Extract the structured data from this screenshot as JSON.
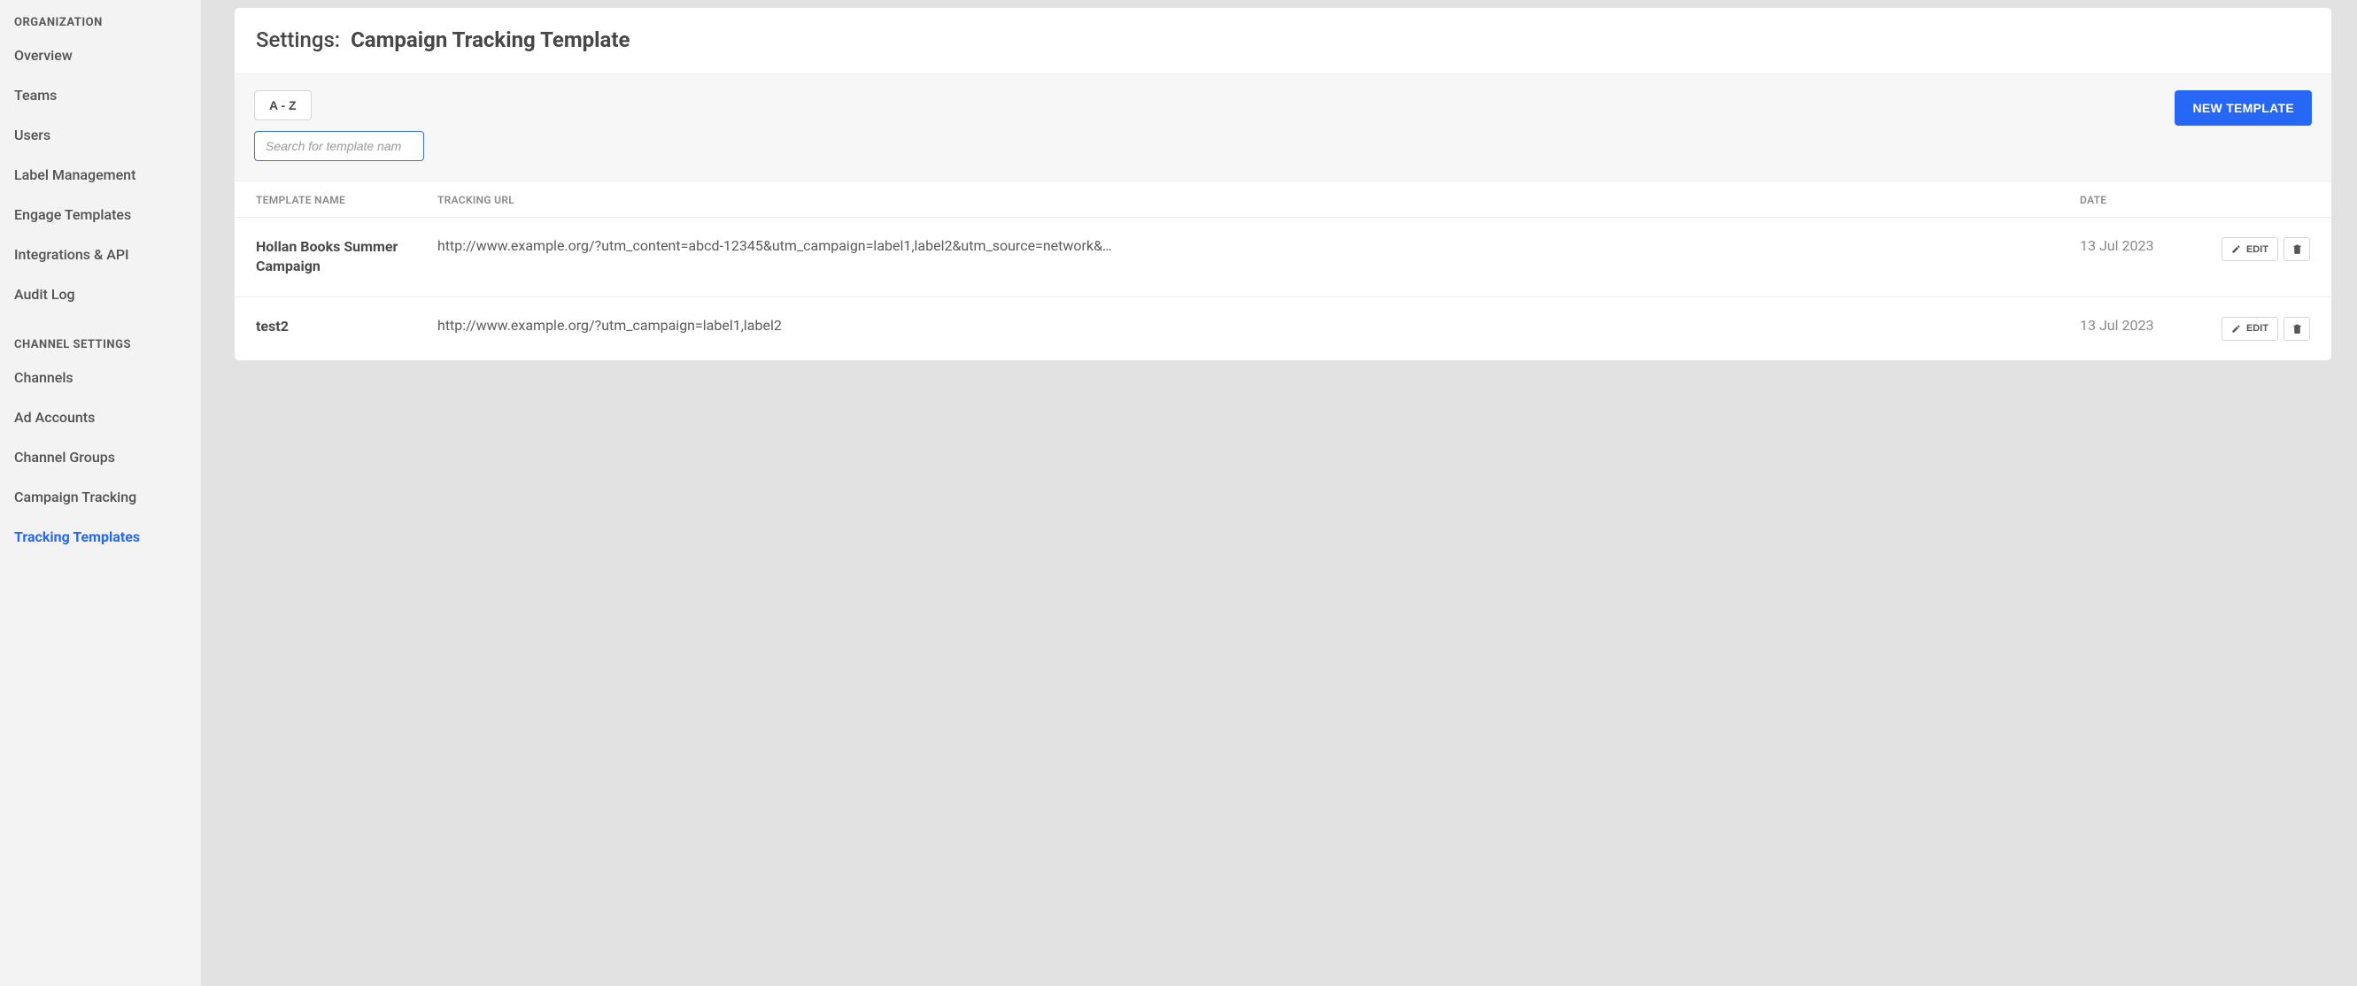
{
  "sidebar": {
    "section1_heading": "ORGANIZATION",
    "section1_items": [
      "Overview",
      "Teams",
      "Users",
      "Label Management",
      "Engage Templates",
      "Integrations & API",
      "Audit Log"
    ],
    "section2_heading": "CHANNEL SETTINGS",
    "section2_items": [
      "Channels",
      "Ad Accounts",
      "Channel Groups",
      "Campaign Tracking",
      "Tracking Templates"
    ],
    "active_item": "Tracking Templates"
  },
  "header": {
    "prefix": "Settings:",
    "title": "Campaign Tracking Template"
  },
  "toolbar": {
    "sort_label": "A - Z",
    "search_placeholder": "Search for template nam",
    "search_value": "",
    "new_button_label": "NEW TEMPLATE"
  },
  "table": {
    "columns": {
      "name": "TEMPLATE NAME",
      "url": "TRACKING URL",
      "date": "DATE"
    },
    "row_edit_label": "EDIT",
    "rows": [
      {
        "name": "Hollan Books Summer Campaign",
        "url": "http://www.example.org/?utm_content=abcd-12345&utm_campaign=label1,label2&utm_source=network&…",
        "date": "13 Jul 2023"
      },
      {
        "name": "test2",
        "url": "http://www.example.org/?utm_campaign=label1,label2",
        "date": "13 Jul 2023"
      }
    ]
  }
}
